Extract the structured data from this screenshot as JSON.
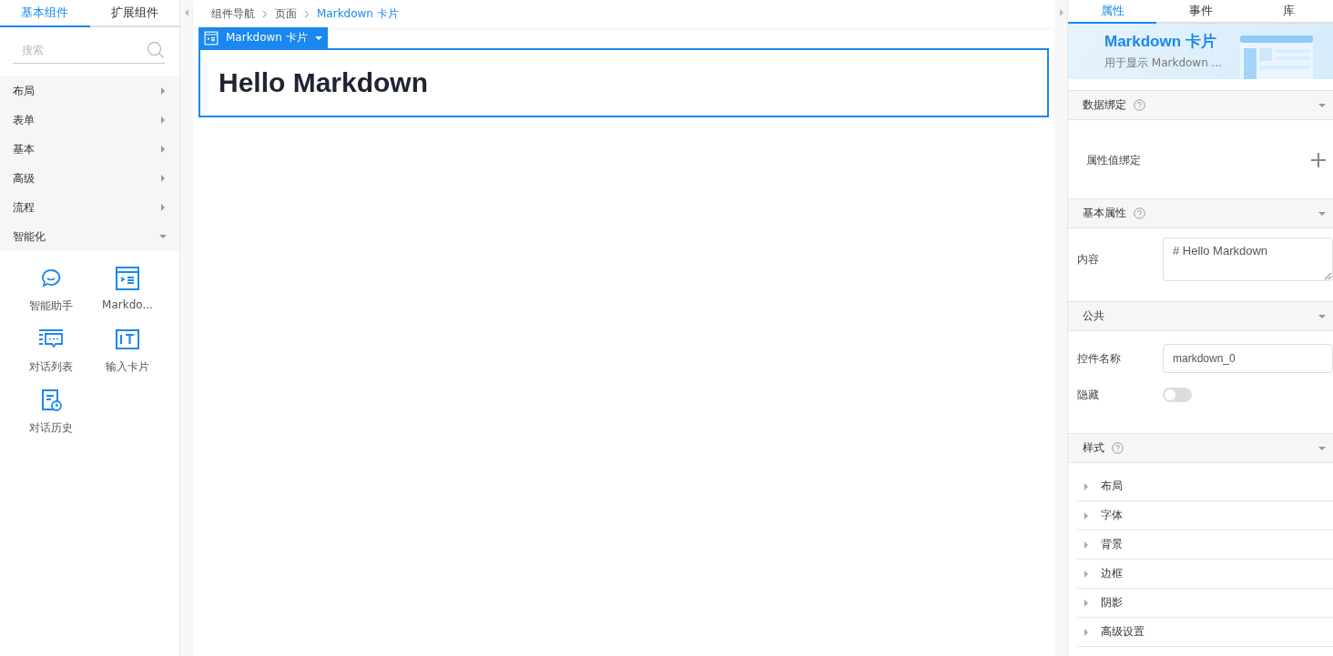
{
  "left_tabs": [
    {
      "label": "基本组件",
      "selected": true
    },
    {
      "label": "扩展组件",
      "selected": false
    }
  ],
  "search": {
    "placeholder": "搜索"
  },
  "categories": [
    {
      "label": "布局",
      "expanded": false
    },
    {
      "label": "表单",
      "expanded": false
    },
    {
      "label": "基本",
      "expanded": false
    },
    {
      "label": "高级",
      "expanded": false
    },
    {
      "label": "流程",
      "expanded": false
    },
    {
      "label": "智能化",
      "expanded": true
    }
  ],
  "components": [
    {
      "kind": "chat",
      "label": "智能助手"
    },
    {
      "kind": "markdown",
      "label": "Markdo..."
    },
    {
      "kind": "list",
      "label": "对话列表"
    },
    {
      "kind": "input",
      "label": "输入卡片"
    },
    {
      "kind": "history",
      "label": "对话历史"
    }
  ],
  "breadcrumb": [
    {
      "label": "组件导航",
      "current": false
    },
    {
      "label": "页面",
      "current": false
    },
    {
      "label": "Markdown 卡片",
      "current": true
    }
  ],
  "selected_component": {
    "tag": "Markdown 卡片",
    "heading": "Hello Markdown"
  },
  "right_tabs": [
    {
      "label": "属性",
      "selected": true
    },
    {
      "label": "事件",
      "selected": false
    },
    {
      "label": "库",
      "selected": false
    }
  ],
  "banner": {
    "title": "Markdown 卡片",
    "subtitle": "用于显示 Markdown ..."
  },
  "sections": [
    {
      "title": "数据绑定",
      "help": true,
      "expanded": true,
      "rows": [
        {
          "kind": "binding",
          "label": "属性值绑定"
        }
      ]
    },
    {
      "title": "基本属性",
      "help": true,
      "expanded": true,
      "rows": [
        {
          "kind": "textarea",
          "label": "内容",
          "value": "# Hello Markdown"
        }
      ]
    },
    {
      "title": "公共",
      "help": false,
      "expanded": true,
      "rows": [
        {
          "kind": "input",
          "label": "控件名称",
          "value": "markdown_0"
        },
        {
          "kind": "switch",
          "label": "隐藏",
          "on": false
        }
      ]
    },
    {
      "title": "样式",
      "help": true,
      "expanded": true,
      "rows": [
        {
          "kind": "group",
          "label": "布局",
          "expanded": false
        },
        {
          "kind": "group",
          "label": "字体",
          "expanded": false
        },
        {
          "kind": "group",
          "label": "背景",
          "expanded": false
        },
        {
          "kind": "group",
          "label": "边框",
          "expanded": false
        },
        {
          "kind": "group",
          "label": "阴影",
          "expanded": false
        },
        {
          "kind": "group",
          "label": "高级设置",
          "expanded": false
        }
      ]
    }
  ]
}
